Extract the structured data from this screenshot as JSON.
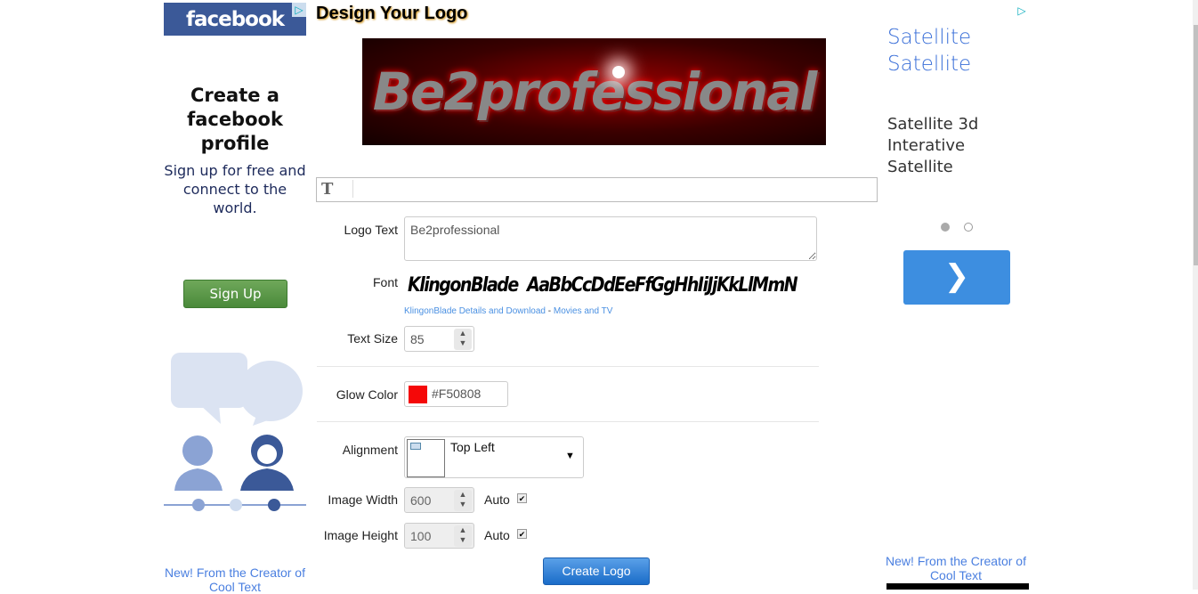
{
  "left_ad": {
    "brand": "facebook",
    "headline": "Create a facebook profile",
    "subtext": "Sign up for free and connect to the world.",
    "button": "Sign Up",
    "footer": "New! From the Creator of Cool Text"
  },
  "page": {
    "title": "Design Your Logo",
    "preview_text": "Be2professional"
  },
  "form": {
    "logo_text_label": "Logo Text",
    "logo_text_value": "Be2professional",
    "font_label": "Font",
    "font_name": "KlingonBlade",
    "font_sample": "KlingonBlade  AaBbCcDdEeFfGgHhIiJjKkLlMmN",
    "font_link": "KlingonBlade Details and Download",
    "font_sep": " - ",
    "category_link": "Movies and TV",
    "text_size_label": "Text Size",
    "text_size_value": "85",
    "glow_color_label": "Glow Color",
    "glow_color_value": "#F50808",
    "glow_color": "#F50808",
    "alignment_label": "Alignment",
    "alignment_value": "Top Left",
    "image_width_label": "Image Width",
    "image_width_value": "600",
    "image_width_auto": "Auto",
    "image_height_label": "Image Height",
    "image_height_value": "100",
    "image_height_auto": "Auto",
    "create_button": "Create Logo"
  },
  "right_ad": {
    "line1": "Satellite",
    "line2": "Satellite",
    "body": "Satellite 3d Interative Satellite",
    "next_icon": "chevron-right-icon",
    "footer": "New! From the Creator of Cool Text"
  }
}
